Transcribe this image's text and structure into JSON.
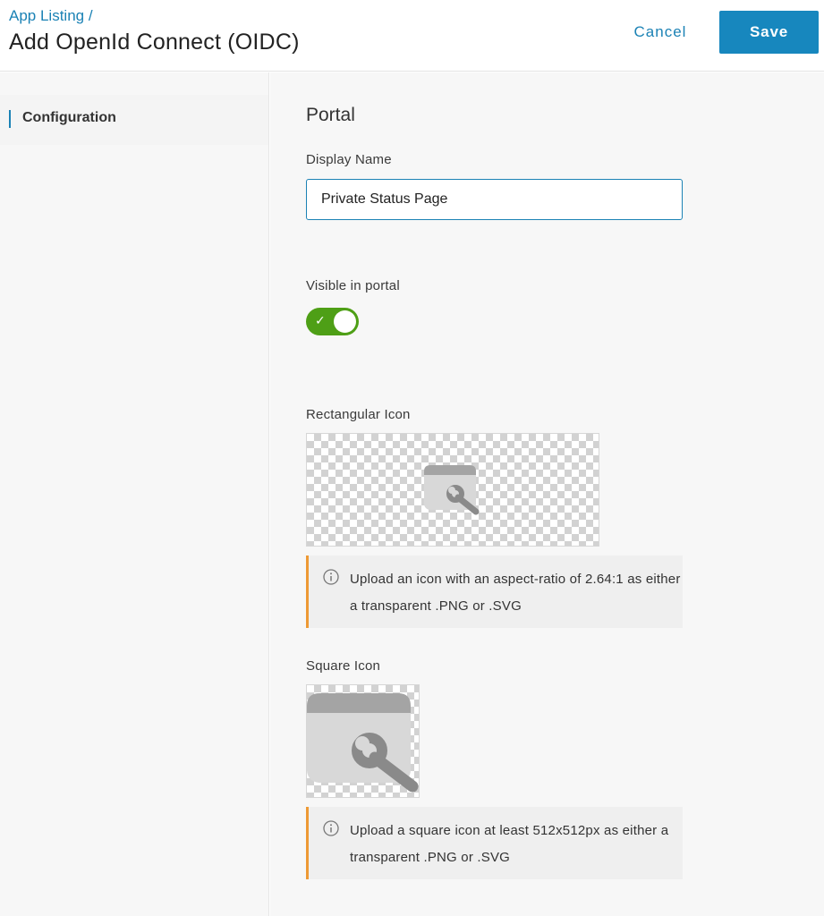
{
  "header": {
    "breadcrumb": "App Listing /",
    "title": "Add OpenId Connect (OIDC)",
    "cancel_label": "Cancel",
    "save_label": "Save"
  },
  "sidebar": {
    "items": [
      {
        "label": "Configuration",
        "active": true
      }
    ]
  },
  "main": {
    "section_title": "Portal",
    "display_name": {
      "label": "Display Name",
      "value": "Private Status Page"
    },
    "visible_in_portal": {
      "label": "Visible in portal",
      "enabled": true
    },
    "rectangular_icon": {
      "label": "Rectangular Icon",
      "note": "Upload an icon with an aspect-ratio of 2.64:1 as either a transparent .PNG or .SVG"
    },
    "square_icon": {
      "label": "Square Icon",
      "note": "Upload a square icon at least 512x512px as either a transparent .PNG or .SVG"
    }
  },
  "colors": {
    "accent": "#1787be",
    "toggle_on": "#4e9f16",
    "note_border": "#ee9a35"
  },
  "icons": {
    "toggle_check": "check-icon",
    "placeholder": "app-placeholder-wrench-icon",
    "info": "info-icon"
  }
}
